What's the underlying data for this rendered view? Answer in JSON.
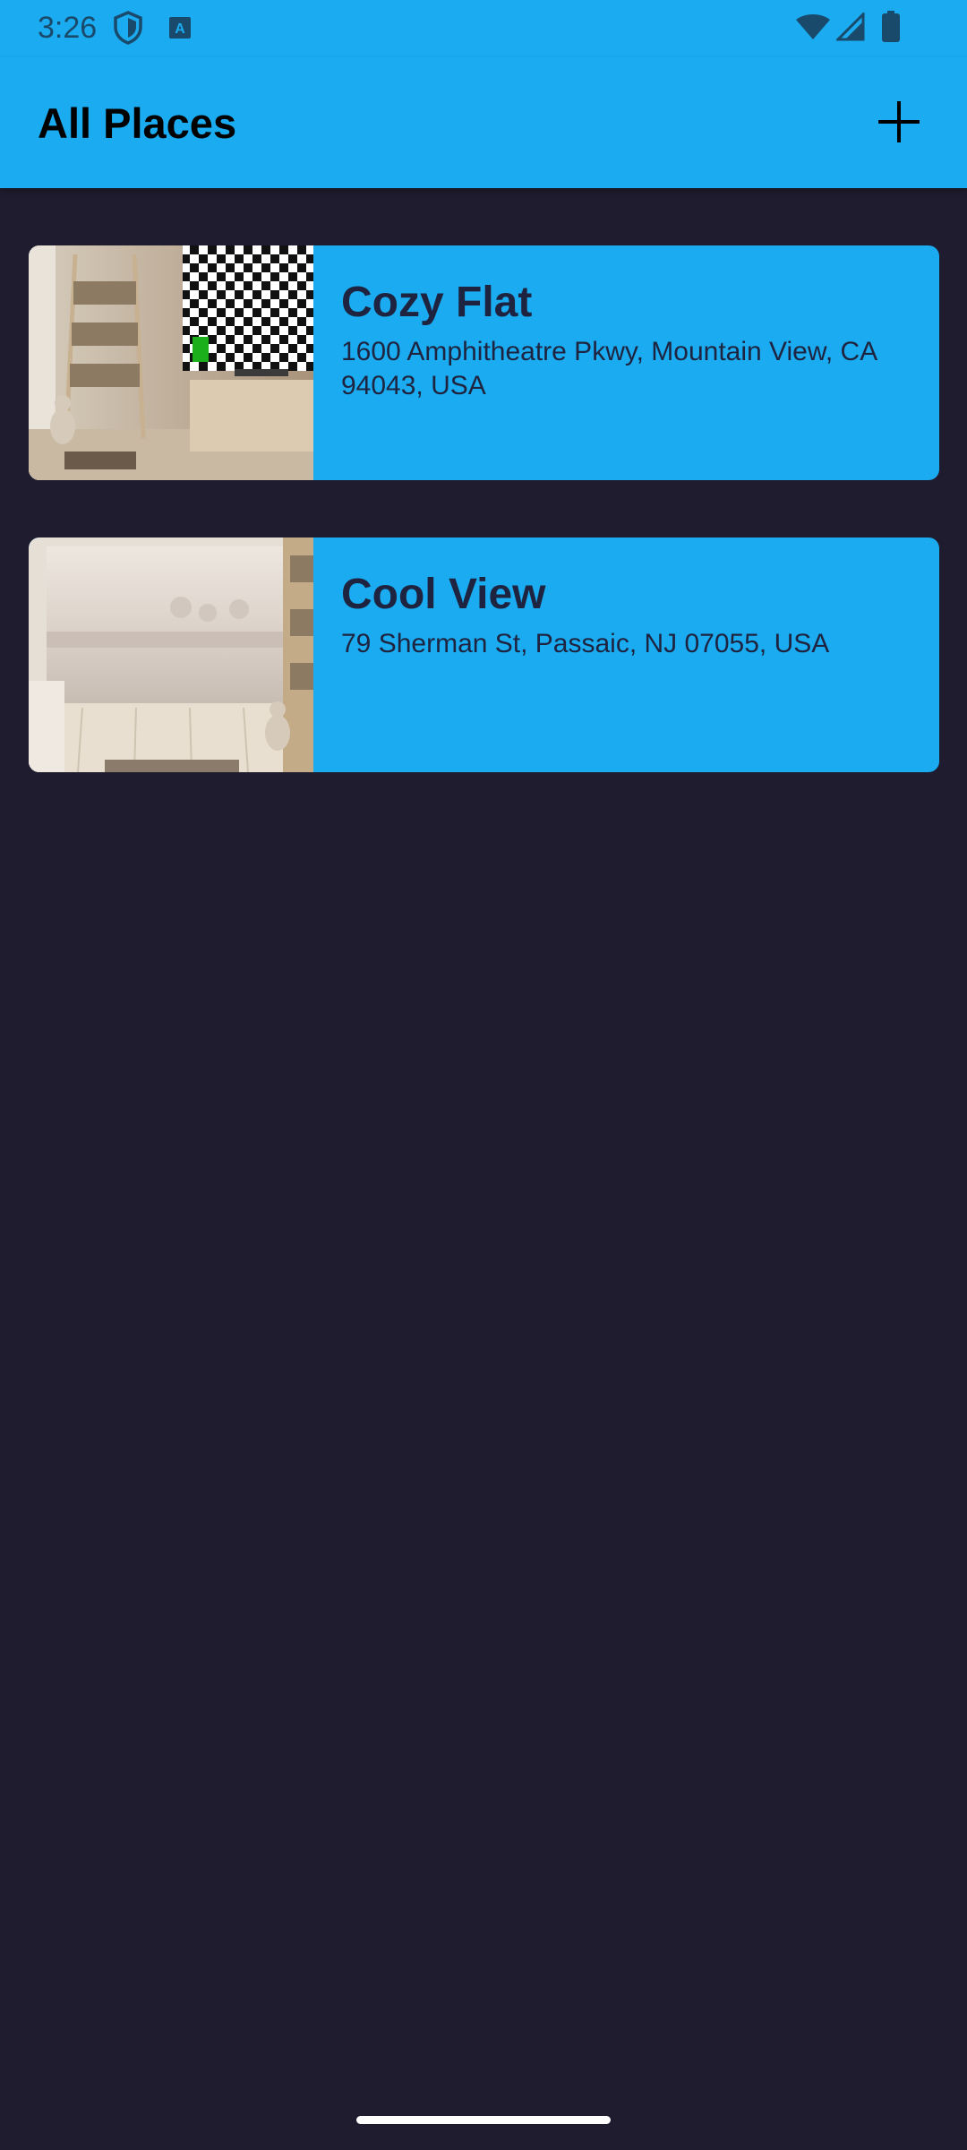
{
  "status_bar": {
    "time": "3:26",
    "icons": [
      "shield-icon",
      "font-app-icon",
      "wifi-icon",
      "cellular-signal-icon",
      "battery-icon"
    ]
  },
  "app_bar": {
    "title": "All Places",
    "add_icon": "plus-icon"
  },
  "places": [
    {
      "title": "Cozy Flat",
      "address": "1600 Amphitheatre Pkwy, Mountain View, CA 94043, USA"
    },
    {
      "title": "Cool View",
      "address": "79 Sherman St, Passaic, NJ 07055, USA"
    }
  ],
  "colors": {
    "app_bar": "#1aabf0",
    "background": "#201c2f",
    "card": "#1aabf0",
    "card_text": "#1e2440"
  }
}
